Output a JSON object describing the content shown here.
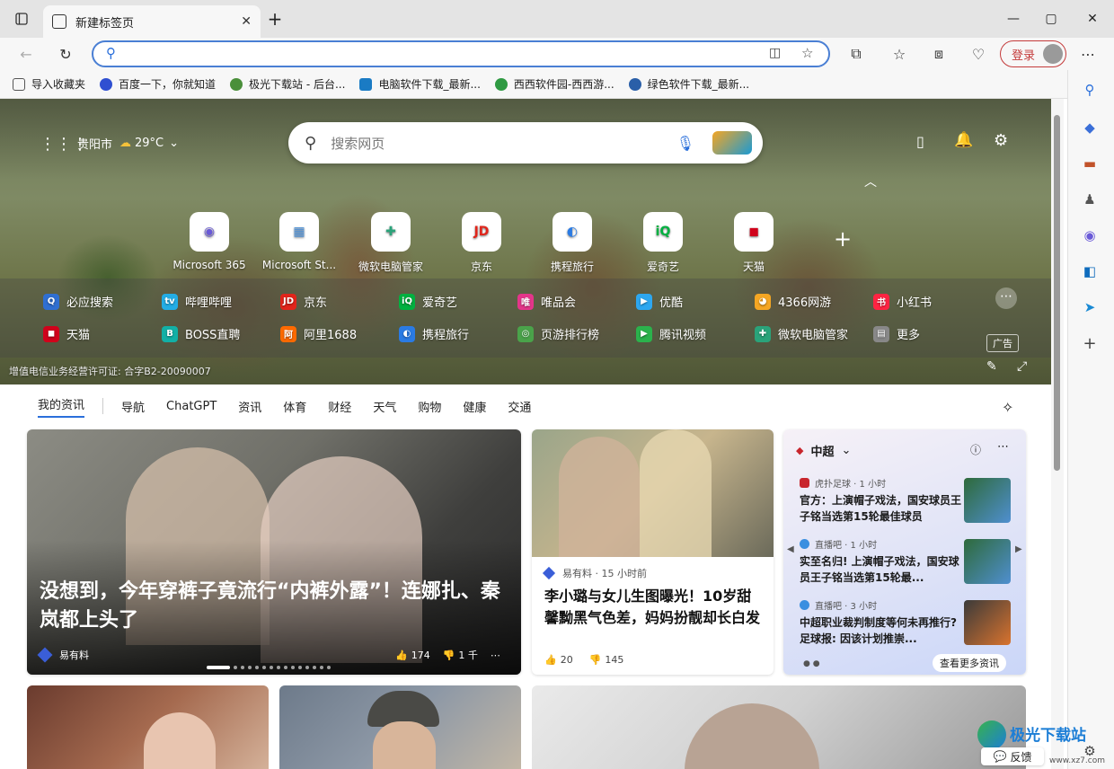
{
  "tab": {
    "title": "新建标签页"
  },
  "toolbar": {
    "login_label": "登录"
  },
  "bookmarks": [
    {
      "label": "导入收藏夹",
      "color": "#555555"
    },
    {
      "label": "百度一下，你就知道",
      "color": "#2f4fd1"
    },
    {
      "label": "极光下载站 - 后台...",
      "color": "#4a8f3a"
    },
    {
      "label": "电脑软件下载_最新...",
      "color": "#1a7bc4"
    },
    {
      "label": "西西软件园-西西游...",
      "color": "#2f9a42"
    },
    {
      "label": "绿色软件下载_最新...",
      "color": "#2a5fa8"
    }
  ],
  "weather": {
    "city": "贵阳市",
    "temp": "29°C"
  },
  "search": {
    "placeholder": "搜索网页"
  },
  "quick_tiles": [
    {
      "label": "Microsoft 365",
      "glyph": "◉",
      "color": "#6a5ad8"
    },
    {
      "label": "Microsoft St...",
      "glyph": "▦",
      "color": "#4a90d9"
    },
    {
      "label": "微软电脑管家",
      "glyph": "✚",
      "color": "#2aa37a"
    },
    {
      "label": "京东",
      "glyph": "JD",
      "color": "#e1251b"
    },
    {
      "label": "携程旅行",
      "glyph": "◐",
      "color": "#2a7be4"
    },
    {
      "label": "爱奇艺",
      "glyph": "iQ",
      "color": "#00b140"
    },
    {
      "label": "天猫",
      "glyph": "◼",
      "color": "#d0021b"
    }
  ],
  "links_row1": [
    {
      "label": "必应搜索",
      "color": "#2f6fd1",
      "glyph": "Q"
    },
    {
      "label": "哔哩哔哩",
      "color": "#23ade5",
      "glyph": "tv"
    },
    {
      "label": "京东",
      "color": "#e1251b",
      "glyph": "JD"
    },
    {
      "label": "爱奇艺",
      "color": "#00b140",
      "glyph": "iQ"
    },
    {
      "label": "唯品会",
      "color": "#e4358a",
      "glyph": "唯"
    },
    {
      "label": "优酷",
      "color": "#2da7f0",
      "glyph": "▶"
    },
    {
      "label": "4366网游",
      "color": "#f5a623",
      "glyph": "◕"
    },
    {
      "label": "小红书",
      "color": "#ff2442",
      "glyph": "书"
    }
  ],
  "links_row2": [
    {
      "label": "天猫",
      "color": "#d0021b",
      "glyph": "◼"
    },
    {
      "label": "BOSS直聘",
      "color": "#12b0a6",
      "glyph": "B"
    },
    {
      "label": "阿里1688",
      "color": "#ff6a00",
      "glyph": "阿"
    },
    {
      "label": "携程旅行",
      "color": "#2a7be4",
      "glyph": "◐"
    },
    {
      "label": "页游排行榜",
      "color": "#4aa34a",
      "glyph": "◎"
    },
    {
      "label": "腾讯视频",
      "color": "#2bb24c",
      "glyph": "▶"
    },
    {
      "label": "微软电脑管家",
      "color": "#2aa37a",
      "glyph": "✚"
    },
    {
      "label": "更多",
      "color": "#888888",
      "glyph": "▤"
    }
  ],
  "ad_label": "广告",
  "license": "增值电信业务经营许可证: 合字B2-20090007",
  "nav_tabs": [
    "我的资讯",
    "导航",
    "ChatGPT",
    "资讯",
    "体育",
    "财经",
    "天气",
    "购物",
    "健康",
    "交通"
  ],
  "card1": {
    "title": "没想到，今年穿裤子竟流行“内裤外露”！连娜扎、秦岚都上头了",
    "source": "易有料",
    "likes": "174",
    "dislikes": "1 千"
  },
  "card2": {
    "source": "易有料 · 15 小时前",
    "title": "李小璐与女儿生图曝光！10岁甜馨黝黑气色差，妈妈扮靓却长白发",
    "likes": "20",
    "dislikes": "145"
  },
  "card3": {
    "category": "中超",
    "items": [
      {
        "source": "虎扑足球 · 1 小时",
        "text": "官方：上演帽子戏法，国安球员王子铭当选第15轮最佳球员",
        "color": "#c8252c"
      },
      {
        "source": "直播吧 · 1 小时",
        "text": "实至名归! 上演帽子戏法，国安球员王子铭当选第15轮最...",
        "color": "#3a8fe0"
      },
      {
        "source": "直播吧 · 3 小时",
        "text": "中超职业裁判制度等何未再推行? 足球报: 因该计划推崇...",
        "color": "#3a8fe0"
      }
    ],
    "more_label": "查看更多资讯"
  },
  "feedback_label": "反馈",
  "watermark": {
    "title": "极光下载站",
    "url": "www.xz7.com"
  }
}
